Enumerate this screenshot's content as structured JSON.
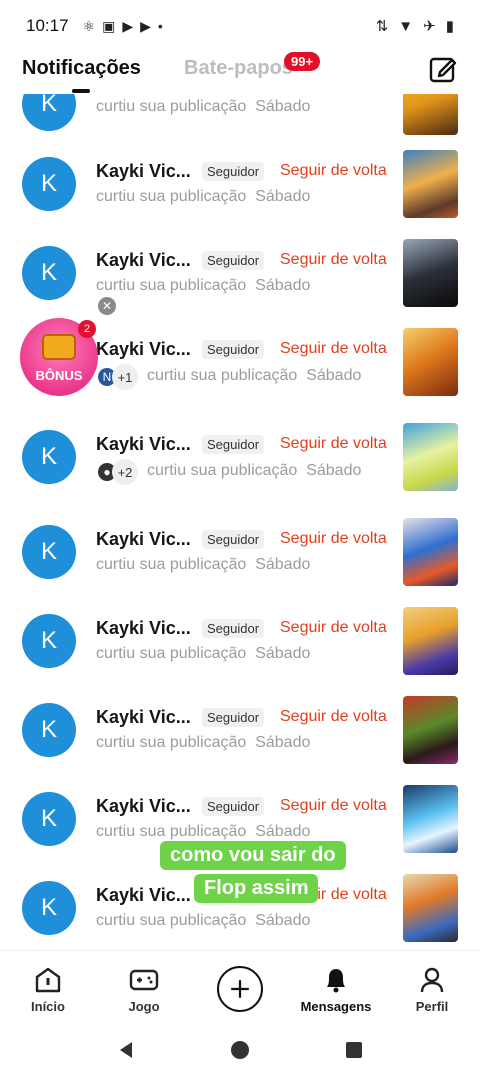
{
  "status": {
    "time": "10:17"
  },
  "tabs": {
    "notifications": "Notificações",
    "chats": "Bate-papos",
    "chats_badge": "99+"
  },
  "common": {
    "name": "Kayki Vic...",
    "tag": "Seguidor",
    "follow_back": "Seguir de volta",
    "action": "curtiu sua publicação",
    "day": "Sábado",
    "avatar_letter": "K"
  },
  "extra": {
    "mini1_letter": "N",
    "plus1": "+1",
    "plus2": "+2"
  },
  "bonus": {
    "label": "BÔNUS",
    "count": "2"
  },
  "caption": {
    "line1": "como vou sair do",
    "line2": "Flop assim"
  },
  "nav": {
    "home": "Início",
    "game": "Jogo",
    "messages": "Mensagens",
    "profile": "Perfil"
  },
  "colors": {
    "accent": "#e2401c",
    "avatar": "#1e8fd8",
    "badge": "#e0102a",
    "caption": "#6fd34a"
  }
}
